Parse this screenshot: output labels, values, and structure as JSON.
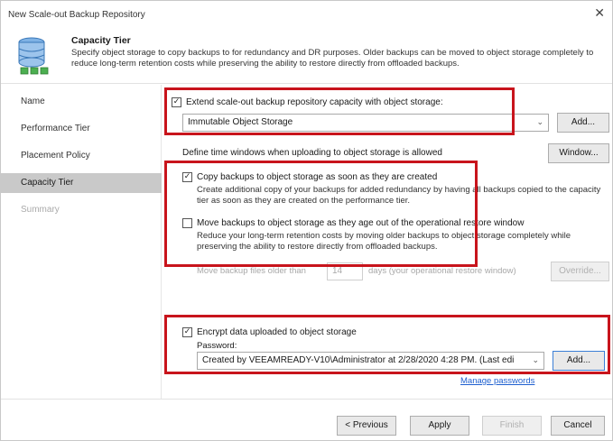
{
  "window": {
    "title": "New Scale-out Backup Repository",
    "close_glyph": "✕"
  },
  "header": {
    "title": "Capacity Tier",
    "description": "Specify object storage to copy backups to for redundancy and DR purposes. Older backups can be moved to object storage completely to reduce long-term retention costs while preserving the ability to restore directly from offloaded backups."
  },
  "sidebar": {
    "items": [
      {
        "label": "Name",
        "state": "normal"
      },
      {
        "label": "Performance Tier",
        "state": "normal"
      },
      {
        "label": "Placement Policy",
        "state": "normal"
      },
      {
        "label": "Capacity Tier",
        "state": "active"
      },
      {
        "label": "Summary",
        "state": "disabled"
      }
    ]
  },
  "capacity": {
    "extend_label": "Extend scale-out backup repository capacity with object storage:",
    "extend_checked": true,
    "storage_value": "Immutable Object Storage",
    "add_label": "Add...",
    "window_desc": "Define time windows when uploading to object storage is allowed",
    "window_label": "Window...",
    "copy_label": "Copy backups to object storage as soon as they are created",
    "copy_checked": true,
    "copy_desc": "Create additional copy of your backups for added redundancy by having all backups copied to the capacity tier as soon as they are created on the performance tier.",
    "move_label": "Move backups to object storage as they age out of the operational restore window",
    "move_checked": false,
    "move_desc": "Reduce your long-term retention costs by moving older backups to object storage completely while preserving the ability to restore directly from offloaded backups.",
    "move_days_prefix": "Move backup files older than",
    "move_days_value": "14",
    "move_days_suffix": "days (your operational restore window)",
    "override_label": "Override...",
    "encrypt_label": "Encrypt data uploaded to object storage",
    "encrypt_checked": true,
    "password_label": "Password:",
    "password_value": "Created by VEEAMREADY-V10\\Administrator at 2/28/2020 4:28 PM. (Last edi",
    "password_add_label": "Add...",
    "manage_passwords": "Manage passwords"
  },
  "footer": {
    "previous": "< Previous",
    "apply": "Apply",
    "finish": "Finish",
    "cancel": "Cancel"
  },
  "colors": {
    "highlight": "#c8141c",
    "active_step": "#c9c9c9",
    "link": "#1e5fcf"
  },
  "icons": {
    "header": "database-stack-icon",
    "close": "close-icon",
    "dropdown": "chevron-down-icon"
  }
}
